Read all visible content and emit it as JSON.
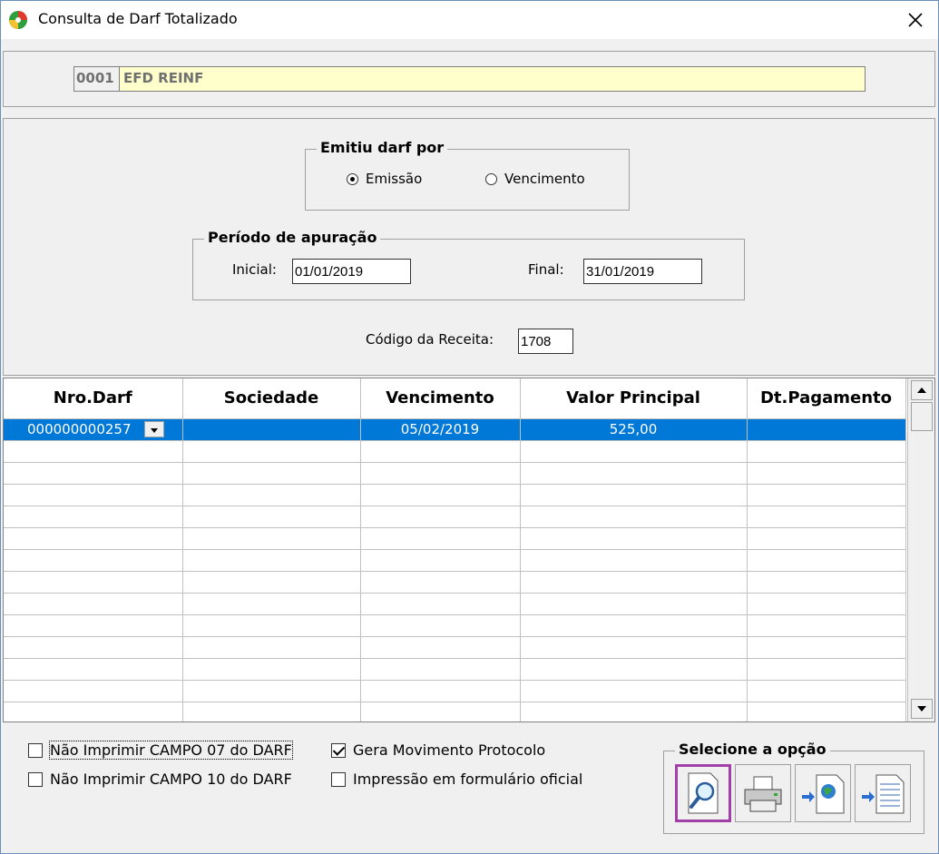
{
  "window": {
    "title": "Consulta de Darf Totalizado",
    "close_glyph": "✕"
  },
  "company": {
    "code": "0001",
    "name": "EFD REINF"
  },
  "emission": {
    "group_title": "Emitiu darf por",
    "options": [
      {
        "label": "Emissão",
        "checked": true
      },
      {
        "label": "Vencimento",
        "checked": false
      }
    ]
  },
  "period": {
    "group_title": "Período de apuração",
    "start_label": "Inicial:",
    "start_value": "01/01/2019",
    "end_label": "Final:",
    "end_value": "31/01/2019"
  },
  "revenue": {
    "label": "Código da Receita:",
    "value": "1708"
  },
  "grid": {
    "columns": [
      "Nro.Darf",
      "Sociedade",
      "Vencimento",
      "Valor Principal",
      "Dt.Pagamento"
    ],
    "rows": [
      {
        "nro_darf": "000000000257",
        "sociedade": "",
        "vencimento": "05/02/2019",
        "valor_principal": "525,00",
        "dt_pagamento": "",
        "selected": true
      }
    ],
    "empty_rows": 13
  },
  "options": {
    "no_print_07": {
      "label": "Não Imprimir CAMPO 07 do DARF",
      "checked": false
    },
    "no_print_10": {
      "label": "Não Imprimir CAMPO 10 do DARF",
      "checked": false
    },
    "gera_movimento": {
      "label": "Gera Movimento Protocolo",
      "checked": true
    },
    "impressao_oficial": {
      "label": "Impressão em formulário oficial",
      "checked": false
    }
  },
  "select_option": {
    "title": "Selecione a opção",
    "buttons": [
      "preview-icon",
      "printer-icon",
      "export-web-icon",
      "export-document-icon"
    ]
  },
  "colors": {
    "selection": "#0078d7",
    "company_bg": "#ffffcc",
    "active_button_border": "#a040a8"
  }
}
